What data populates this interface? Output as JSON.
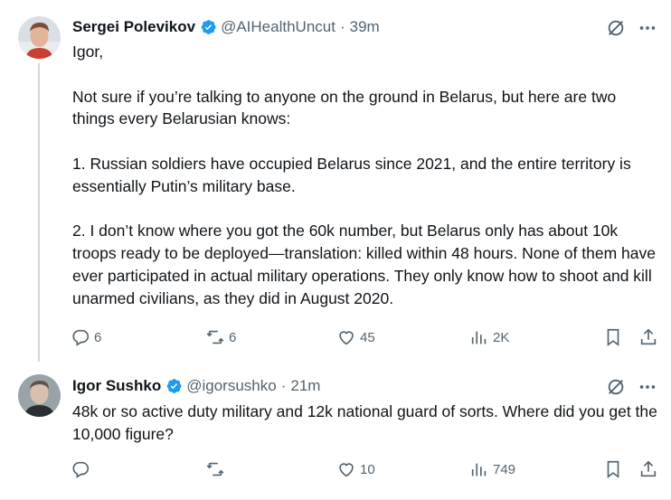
{
  "tweets": [
    {
      "author": {
        "name": "Sergei Polevikov",
        "handle": "@AIHealthUncut",
        "time": "39m"
      },
      "body": [
        "Igor,",
        "Not sure if you’re talking to anyone on the ground in Belarus, but here are two things every Belarusian knows:",
        "1. Russian soldiers have occupied Belarus since 2021, and the entire territory is essentially Putin’s military base.",
        "2. I don’t know where you got the 60k number, but Belarus only has about 10k troops ready to be deployed—translation: killed within 48 hours. None of them have ever participated in actual military operations. They only know how to shoot and kill unarmed civilians, as they did in August 2020."
      ],
      "stats": {
        "replies": "6",
        "retweets": "6",
        "likes": "45",
        "views": "2K"
      }
    },
    {
      "author": {
        "name": "Igor Sushko",
        "handle": "@igorsushko",
        "time": "21m"
      },
      "body": [
        "48k or so active duty military and 12k national guard of sorts. Where did you get the 10,000 figure?"
      ],
      "stats": {
        "replies": "",
        "retweets": "",
        "likes": "10",
        "views": "749"
      }
    }
  ],
  "separator": "·",
  "colors": {
    "text": "#0f1419",
    "secondary": "#536471",
    "verified": "#1d9bf0",
    "thread_line": "#cfd9de"
  },
  "icons": [
    "verified-badge-icon",
    "grok-icon",
    "more-icon",
    "reply-icon",
    "retweet-icon",
    "like-icon",
    "views-icon",
    "bookmark-icon",
    "share-icon"
  ]
}
